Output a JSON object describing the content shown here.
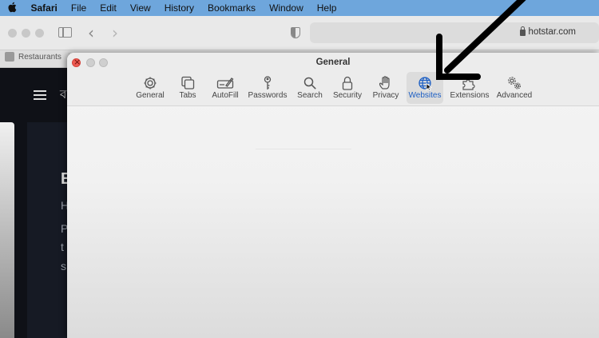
{
  "menubar": {
    "apple_icon": "apple-logo-icon",
    "items": [
      "Safari",
      "File",
      "Edit",
      "View",
      "History",
      "Bookmarks",
      "Window",
      "Help"
    ]
  },
  "safari": {
    "address": "hotstar.com",
    "tabs": [
      {
        "label": "Restaurants"
      }
    ]
  },
  "prefs": {
    "title": "General",
    "tabs": [
      {
        "label": "General",
        "icon": "gear-icon"
      },
      {
        "label": "Tabs",
        "icon": "tabs-icon"
      },
      {
        "label": "AutoFill",
        "icon": "autofill-icon"
      },
      {
        "label": "Passwords",
        "icon": "key-icon"
      },
      {
        "label": "Search",
        "icon": "search-icon"
      },
      {
        "label": "Security",
        "icon": "lock-icon"
      },
      {
        "label": "Privacy",
        "icon": "hand-icon"
      },
      {
        "label": "Websites",
        "icon": "globe-icon"
      },
      {
        "label": "Extensions",
        "icon": "puzzle-icon"
      },
      {
        "label": "Advanced",
        "icon": "gears-icon"
      }
    ],
    "active_tab": "Websites"
  },
  "colors": {
    "menubar": "#6ea6dc",
    "active_label": "#1d5fc4",
    "close_button": "#ee5b52"
  }
}
